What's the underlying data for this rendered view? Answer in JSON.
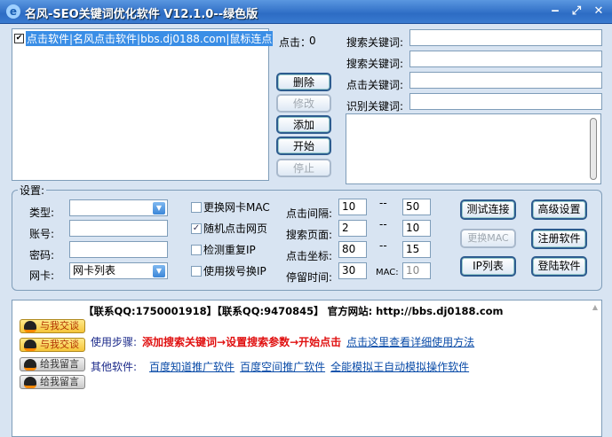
{
  "window": {
    "title": "名风-SEO关键词优化软件 V12.1.0--绿色版",
    "minimize": "‒",
    "maximize": "⤢",
    "close": "✕"
  },
  "list": {
    "items": [
      {
        "checked": true,
        "check_mark": "✔",
        "text": "点击软件|名风点击软件|bbs.dj0188.com|鼠标连点"
      }
    ]
  },
  "click_count": {
    "label": "点击：",
    "value": "0"
  },
  "actions": {
    "delete": "删除",
    "edit": "修改",
    "add": "添加",
    "start": "开始",
    "stop": "停止"
  },
  "keywords": [
    {
      "label": "搜索关键词:",
      "value": ""
    },
    {
      "label": "搜索关键词:",
      "value": ""
    },
    {
      "label": "点击关键词:",
      "value": ""
    },
    {
      "label": "识别关键词:",
      "value": ""
    }
  ],
  "settings": {
    "title": "设置:",
    "type": {
      "label": "类型:",
      "value": ""
    },
    "account": {
      "label": "账号:",
      "value": ""
    },
    "password": {
      "label": "密码:",
      "value": ""
    },
    "nic": {
      "label": "网卡:",
      "value": "网卡列表"
    },
    "checks": [
      {
        "label": "更换网卡MAC",
        "checked": false
      },
      {
        "label": "随机点击网页",
        "checked": true,
        "mark": "✓"
      },
      {
        "label": "检测重复IP",
        "checked": false
      },
      {
        "label": "使用拨号换IP",
        "checked": false
      }
    ],
    "ranges": [
      {
        "label": "点击间隔:",
        "from": "10",
        "sep": "--",
        "to": "50"
      },
      {
        "label": "搜索页面:",
        "from": "2",
        "sep": "--",
        "to": "10"
      },
      {
        "label": "点击坐标:",
        "from": "80",
        "sep": "--",
        "to": "15"
      },
      {
        "label": "停留时间:",
        "from": "30",
        "sep": "MAC:",
        "to": "10"
      }
    ],
    "buttons": {
      "test": "测试连接",
      "advanced": "高级设置",
      "change_mac": "更换MAC",
      "register": "注册软件",
      "ip_list": "IP列表",
      "login": "登陆软件"
    }
  },
  "info": {
    "contact": "【联系QQ:1750001918】【联系QQ:9470845】 官方网站: http://bbs.dj0188.com",
    "qq_chat": "与我交谈",
    "qq_msg": "给我留言",
    "steps_label": "使用步骤:",
    "steps": "添加搜索关键词→设置搜索参数→开始点击",
    "steps_link": "点击这里查看详细使用方法",
    "other_label": "其他软件:",
    "other_links": [
      "百度知道推广软件",
      "百度空间推广软件",
      "全能模拟王自动模拟操作软件"
    ],
    "scroll_up": "▲"
  }
}
